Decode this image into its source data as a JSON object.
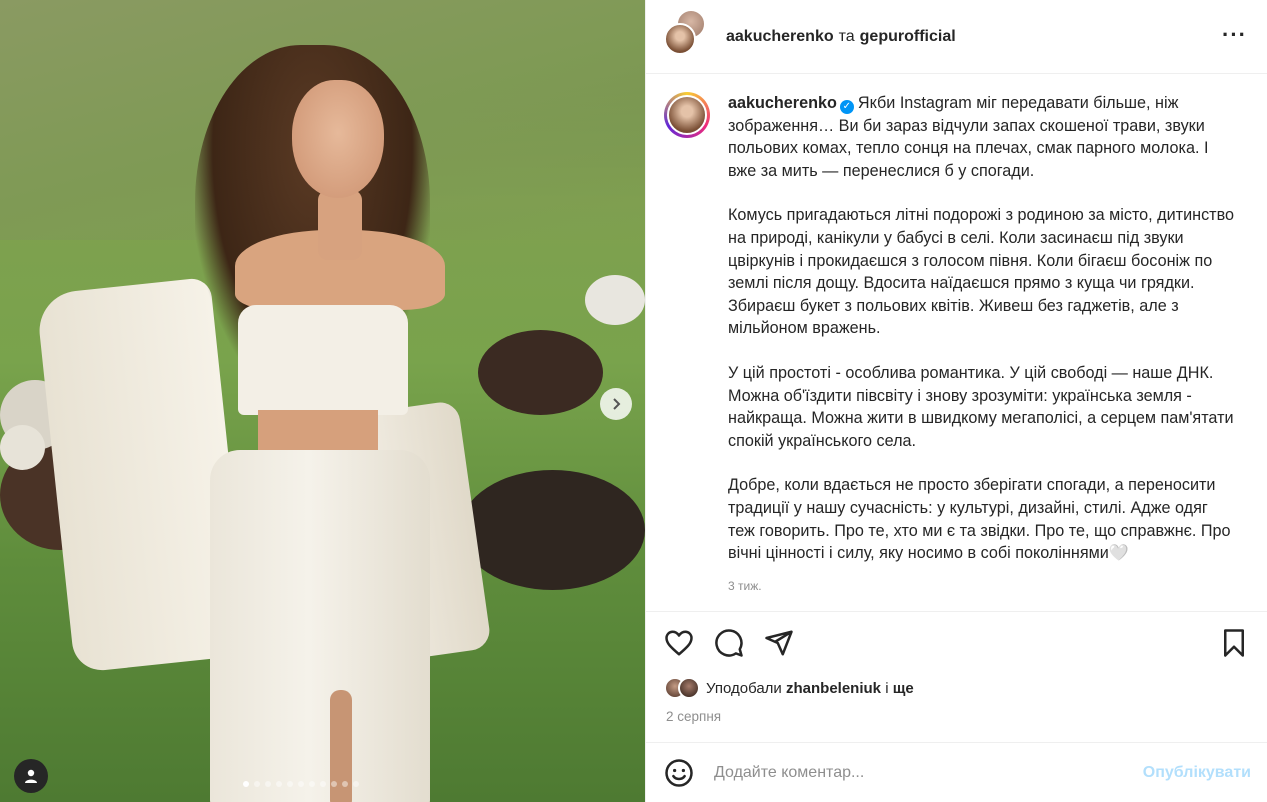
{
  "header": {
    "author": "aakucherenko",
    "connector": "та",
    "collaborator": "gepurofficial"
  },
  "caption": {
    "username": "aakucherenko",
    "paragraphs": [
      "Якби Instagram міг передавати більше, ніж зображення… Ви би зараз відчули запах скошеної трави, звуки польових комах, тепло сонця на плечах, смак парного молока. І вже за мить — перенеслися б у спогади.",
      "Комусь пригадаються літні подорожі з родиною за місто, дитинство на природі, канікули у бабусі в селі. Коли засинаєш під звуки цвіркунів і прокидаєшся з голосом півня. Коли бігаєш босоніж по землі після дощу. Вдосита наїдаєшся прямо з куща чи грядки. Збираєш букет з польових квітів. Живеш без гаджетів, але з мільйоном вражень.",
      "У цій простоті - особлива романтика. У цій свободі — наше ДНК. Можна об'їздити півсвіту і знову зрозуміти: українська земля - найкраща. Можна жити в швидкому мегаполісі, а серцем пам'ятати спокій українського села.",
      "Добре, коли вдається не просто зберігати спогади, а переносити традиції у нашу сучасність: у культурі, дизайні, стилі. Адже одяг теж говорить. Про те, хто ми є та звідки. Про те, що справжнє. Про вічні цінності і силу, яку носимо в собі поколіннями"
    ],
    "heart_emoji": "🤍",
    "time_ago": "3 тиж."
  },
  "likes": {
    "prefix": "Уподобали",
    "user": "zhanbeleniuk",
    "separator": "і",
    "more": "ще"
  },
  "date": "2 серпня",
  "comment": {
    "placeholder": "Додайте коментар...",
    "publish_label": "Опублікувати"
  },
  "carousel": {
    "total": 11,
    "active_index": 0
  },
  "colors": {
    "verified": "#0095f6",
    "publish_disabled": "#b2dffc",
    "meta_text": "#8e8e8e"
  }
}
